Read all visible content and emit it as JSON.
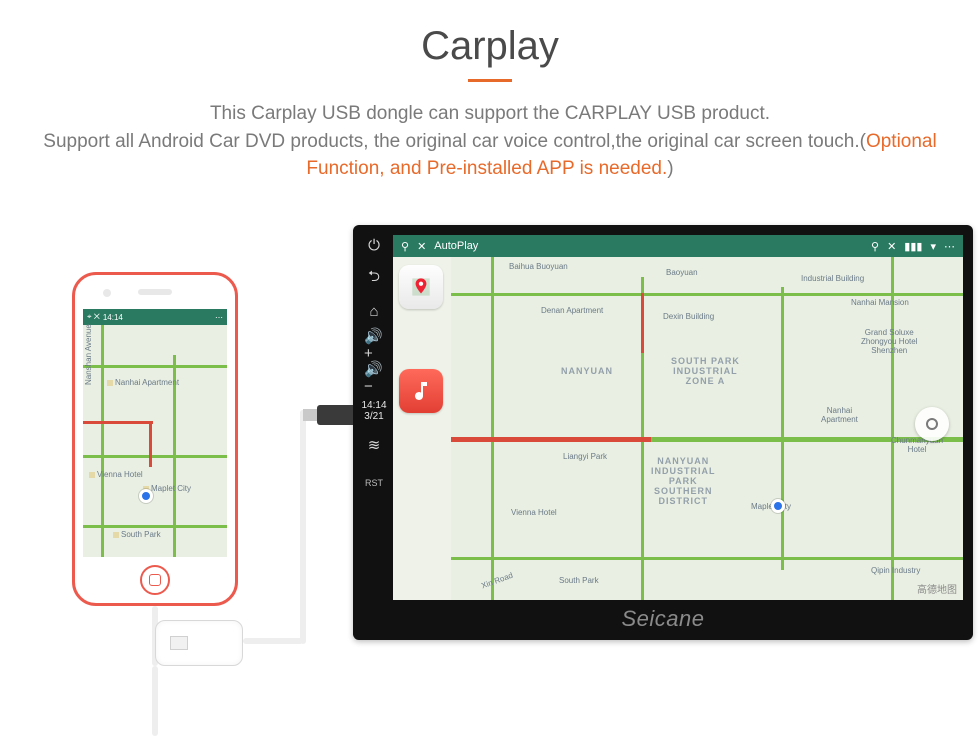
{
  "header": {
    "title": "Carplay",
    "description_1": "This Carplay USB dongle can support the CARPLAY USB product.",
    "description_2a": "Support all Android Car DVD products, the original car voice control,the original car screen touch.(",
    "description_2_highlight": "Optional Function, and Pre-installed APP is needed.",
    "description_2b": ")"
  },
  "phone": {
    "status_time": "14:14",
    "status_icons_left": "⌖ ✕",
    "status_icons_right": "⋯",
    "map": {
      "street_vertical": "Nanshan Avenue",
      "poi_1": "Nanhai Apartment",
      "poi_2": "Vienna Hotel",
      "poi_3": "Maplet City",
      "poi_4": "South Park"
    }
  },
  "unit": {
    "brand": "Seicane",
    "sidebar": {
      "power": "⏻",
      "back": "⮌",
      "home": "⌂",
      "vol_up": "🔊+",
      "vol_dn": "🔊−",
      "clock": "14:14\n3/21",
      "wifi": "≋",
      "rst": "RST"
    },
    "topbar": {
      "app_name": "AutoPlay",
      "pin": "⚲",
      "mute": "✕",
      "bars": "▮▮▮",
      "caret": "▾",
      "dots": "⋯"
    },
    "apps": {
      "maps": "maps-app",
      "phone": "phone-app",
      "music": "music-app"
    },
    "map": {
      "areas": {
        "nanyuan": "NANYUAN",
        "southpark": "SOUTH PARK\nINDUSTRIAL\nZONE A",
        "nanyuan_ind": "NANYUAN\nINDUSTRIAL\nPARK\nSOUTHERN\nDISTRICT"
      },
      "labels": {
        "baihua": "Baihua Buoyuan",
        "baoyuan": "Baoyuan",
        "denan": "Denan Apartment",
        "dexin": "Dexin Building",
        "industrial": "Industrial Building",
        "nanhai_mansion": "Nanhai Mansion",
        "grand_soluxe": "Grand Soluxe\nZhongyou Hotel\nShenzhen",
        "nanhai": "Nanhai\nApartment",
        "chunman": "Chunmanyuan\nHotel",
        "vienna": "Vienna Hotel",
        "maplet": "Maplet City",
        "qipin": "Qipin Industry",
        "southpark_lbl": "South Park",
        "liangyi": "Liangyi Park",
        "xin_road": "Xin Road"
      },
      "attribution": "高德地图"
    }
  }
}
